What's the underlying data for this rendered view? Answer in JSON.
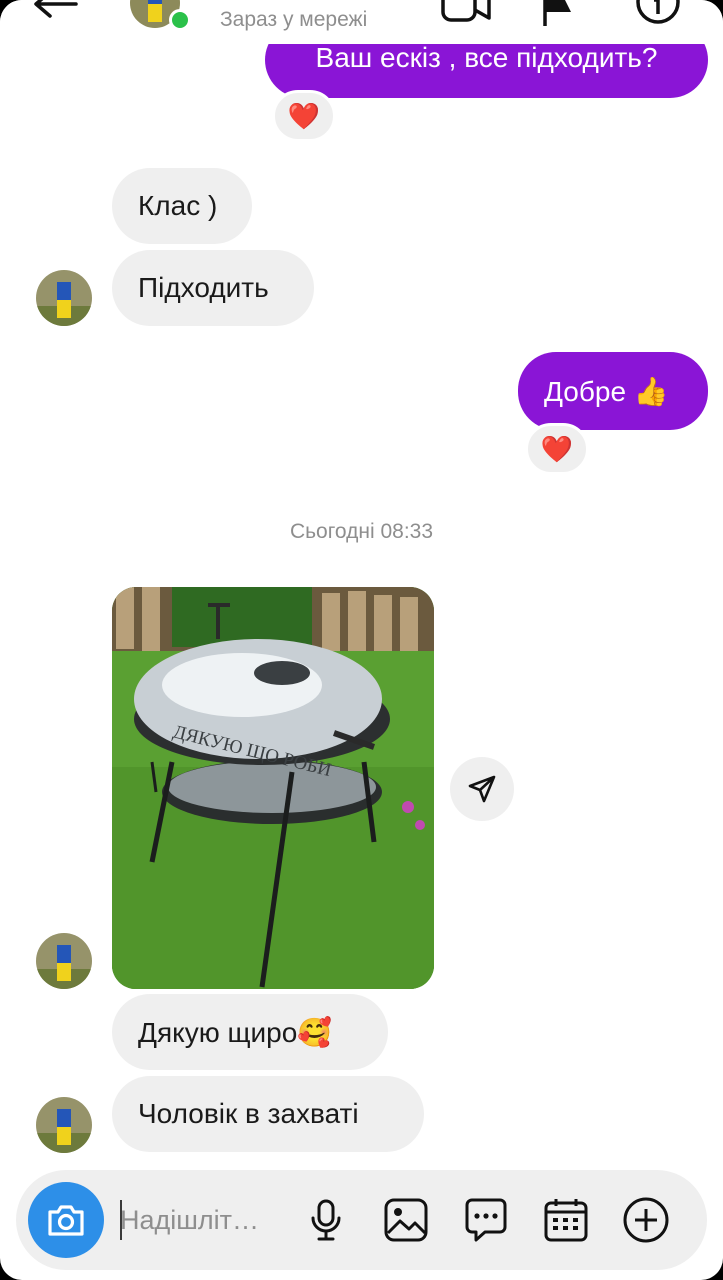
{
  "header": {
    "status": "Зараз у мережі",
    "icons": [
      "back-arrow-icon",
      "video-call-icon",
      "flag-icon",
      "info-icon"
    ]
  },
  "messages": {
    "outgoing_1": "Ваш ескіз , все підходить?",
    "incoming_1": "Клас )",
    "incoming_2": "Підходить",
    "outgoing_2": "Добре 👍",
    "timestamp": "Сьогодні 08:33",
    "photo_text": "ДЯКУЮ ЩО РОБИ",
    "incoming_3": "Дякую щиро🥰",
    "incoming_4": "Чоловік в захваті",
    "reaction": "❤️"
  },
  "composer": {
    "placeholder": "Надішліт…",
    "icons": [
      "camera-icon",
      "microphone-icon",
      "gallery-icon",
      "sticker-chat-icon",
      "calendar-icon",
      "add-icon"
    ]
  },
  "colors": {
    "outgoing_bubble": "#8a15d6",
    "incoming_bubble": "#efefef",
    "online": "#2bc14a",
    "camera": "#2d8fe8"
  }
}
